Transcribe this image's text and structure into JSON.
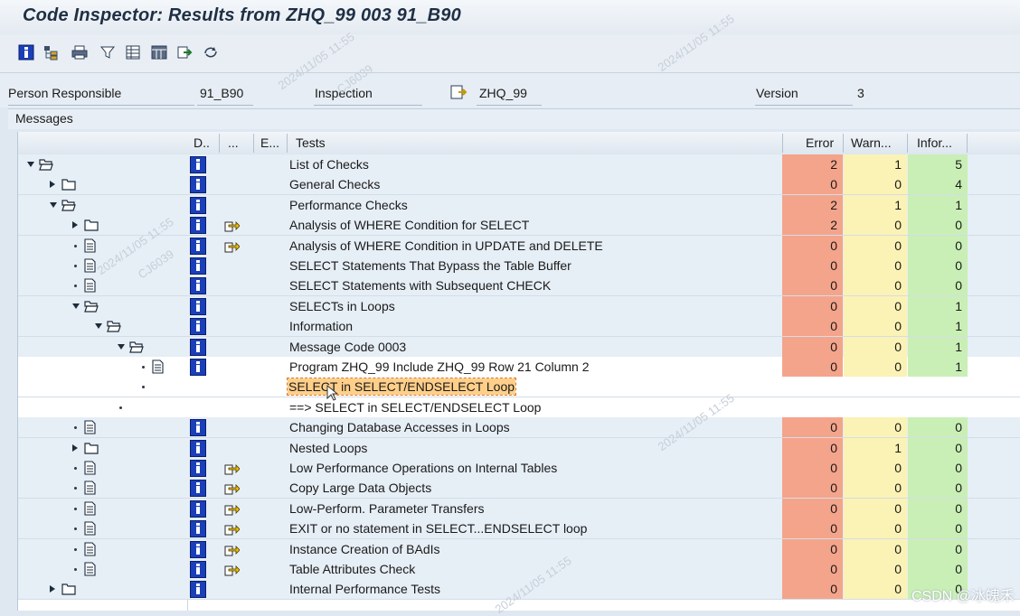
{
  "window": {
    "title": "Code Inspector: Results from ZHQ_99 003 91_B90"
  },
  "toolbar": {
    "icons": [
      "info-icon",
      "hierarchy-icon",
      "print-icon",
      "filter-icon",
      "columns-icon",
      "layout-icon",
      "export-icon",
      "refresh-icon"
    ]
  },
  "header": {
    "person_label": "Person Responsible",
    "person_value": "91_B90",
    "inspection_label": "Inspection",
    "inspection_value": "ZHQ_99",
    "version_label": "Version",
    "version_value": "3"
  },
  "messages_label": "Messages",
  "columns": {
    "d": "D..",
    "dots": "...",
    "e": "E...",
    "tests": "Tests",
    "error": "Error",
    "warn": "Warn...",
    "info": "Infor..."
  },
  "rows": [
    {
      "indent": 0,
      "node": "folder-open",
      "exp": "down",
      "info": true,
      "go": false,
      "text": "List of Checks",
      "error": "2",
      "warn": "1",
      "inf": "5",
      "style": "alt"
    },
    {
      "indent": 1,
      "node": "folder",
      "exp": "right",
      "info": true,
      "go": false,
      "text": "General Checks",
      "error": "0",
      "warn": "0",
      "inf": "4",
      "style": "alt"
    },
    {
      "indent": 1,
      "node": "folder-open",
      "exp": "down",
      "info": true,
      "go": false,
      "text": "Performance Checks",
      "error": "2",
      "warn": "1",
      "inf": "1",
      "style": "alt"
    },
    {
      "indent": 2,
      "node": "folder",
      "exp": "right",
      "info": true,
      "go": true,
      "text": "Analysis of WHERE Condition for SELECT",
      "error": "2",
      "warn": "0",
      "inf": "0",
      "style": "alt"
    },
    {
      "indent": 2,
      "node": "doc",
      "exp": "bullet",
      "info": true,
      "go": true,
      "text": "Analysis of WHERE Condition in UPDATE and DELETE",
      "error": "0",
      "warn": "0",
      "inf": "0",
      "style": "alt"
    },
    {
      "indent": 2,
      "node": "doc",
      "exp": "bullet",
      "info": true,
      "go": false,
      "text": "SELECT Statements That Bypass the Table Buffer",
      "error": "0",
      "warn": "0",
      "inf": "0",
      "style": "alt"
    },
    {
      "indent": 2,
      "node": "doc",
      "exp": "bullet",
      "info": true,
      "go": false,
      "text": "SELECT Statements with Subsequent CHECK",
      "error": "0",
      "warn": "0",
      "inf": "0",
      "style": "alt"
    },
    {
      "indent": 2,
      "node": "folder-open",
      "exp": "down",
      "info": true,
      "go": false,
      "text": "SELECTs in Loops",
      "error": "0",
      "warn": "0",
      "inf": "1",
      "style": "alt"
    },
    {
      "indent": 3,
      "node": "folder-open",
      "exp": "down",
      "info": true,
      "go": false,
      "text": "Information",
      "error": "0",
      "warn": "0",
      "inf": "1",
      "style": "alt"
    },
    {
      "indent": 4,
      "node": "folder-open",
      "exp": "down",
      "info": true,
      "go": false,
      "text": "Message Code 0003",
      "error": "0",
      "warn": "0",
      "inf": "1",
      "style": "alt"
    },
    {
      "indent": 5,
      "node": "doc",
      "exp": "bullet",
      "info": true,
      "go": false,
      "text": "Program ZHQ_99 Include ZHQ_99 Row 21 Column 2",
      "error": "0",
      "warn": "0",
      "inf": "1",
      "style": "plain"
    },
    {
      "indent": 5,
      "node": "none",
      "exp": "bullet",
      "info": false,
      "go": false,
      "text": "SELECT in SELECT/ENDSELECT Loop",
      "error": "",
      "warn": "",
      "inf": "",
      "style": "plain",
      "highlight": true
    },
    {
      "indent": 4,
      "node": "none",
      "exp": "bullet",
      "info": false,
      "go": false,
      "text": "==> SELECT in SELECT/ENDSELECT Loop",
      "error": "",
      "warn": "",
      "inf": "",
      "style": "plain"
    },
    {
      "indent": 2,
      "node": "doc",
      "exp": "bullet",
      "info": true,
      "go": false,
      "text": "Changing Database Accesses in Loops",
      "error": "0",
      "warn": "0",
      "inf": "0",
      "style": "alt"
    },
    {
      "indent": 2,
      "node": "folder",
      "exp": "right",
      "info": true,
      "go": false,
      "text": "Nested Loops",
      "error": "0",
      "warn": "1",
      "inf": "0",
      "style": "alt"
    },
    {
      "indent": 2,
      "node": "doc",
      "exp": "bullet",
      "info": true,
      "go": true,
      "text": "Low Performance Operations on Internal Tables",
      "error": "0",
      "warn": "0",
      "inf": "0",
      "style": "alt"
    },
    {
      "indent": 2,
      "node": "doc",
      "exp": "bullet",
      "info": true,
      "go": true,
      "text": "Copy Large Data Objects",
      "error": "0",
      "warn": "0",
      "inf": "0",
      "style": "alt"
    },
    {
      "indent": 2,
      "node": "doc",
      "exp": "bullet",
      "info": true,
      "go": true,
      "text": "Low-Perform. Parameter Transfers",
      "error": "0",
      "warn": "0",
      "inf": "0",
      "style": "alt"
    },
    {
      "indent": 2,
      "node": "doc",
      "exp": "bullet",
      "info": true,
      "go": true,
      "text": "EXIT or no statement in SELECT...ENDSELECT loop",
      "error": "0",
      "warn": "0",
      "inf": "0",
      "style": "alt"
    },
    {
      "indent": 2,
      "node": "doc",
      "exp": "bullet",
      "info": true,
      "go": true,
      "text": "Instance Creation of BAdIs",
      "error": "0",
      "warn": "0",
      "inf": "0",
      "style": "alt"
    },
    {
      "indent": 2,
      "node": "doc",
      "exp": "bullet",
      "info": true,
      "go": true,
      "text": "Table Attributes Check",
      "error": "0",
      "warn": "0",
      "inf": "0",
      "style": "alt"
    },
    {
      "indent": 1,
      "node": "folder",
      "exp": "right",
      "info": true,
      "go": false,
      "text": "Internal Performance Tests",
      "error": "0",
      "warn": "0",
      "inf": "0",
      "style": "alt"
    }
  ],
  "watermark": {
    "date": "2024/11/05 11:55",
    "user": "CJ6039"
  },
  "credit": "CSDN @冰魄禾"
}
